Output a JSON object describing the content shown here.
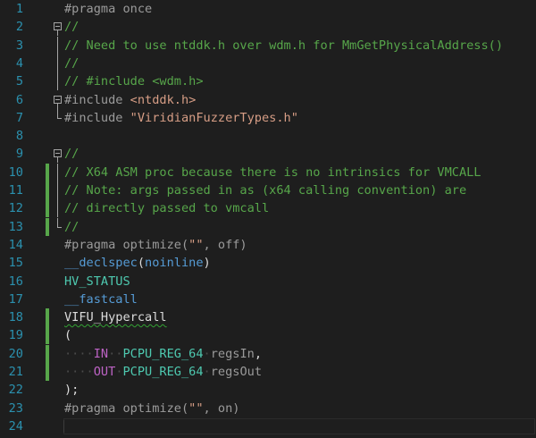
{
  "editor": {
    "language": "C",
    "lines": [
      {
        "number": "1",
        "parts": [
          {
            "t": "pp",
            "s": "#pragma once"
          }
        ]
      },
      {
        "number": "2",
        "parts": [
          {
            "t": "cm",
            "s": "//"
          }
        ]
      },
      {
        "number": "3",
        "parts": [
          {
            "t": "cm",
            "s": "// Need to use ntddk.h over wdm.h for MmGetPhysicalAddress()"
          }
        ]
      },
      {
        "number": "4",
        "parts": [
          {
            "t": "cm",
            "s": "//"
          }
        ]
      },
      {
        "number": "5",
        "parts": [
          {
            "t": "cm",
            "s": "// #include <wdm.h>"
          }
        ]
      },
      {
        "number": "6",
        "parts": [
          {
            "t": "pp",
            "s": "#include "
          },
          {
            "t": "str",
            "s": "<ntddk.h>"
          }
        ]
      },
      {
        "number": "7",
        "parts": [
          {
            "t": "pp",
            "s": "#include "
          },
          {
            "t": "str",
            "s": "\"ViridianFuzzerTypes.h\""
          }
        ]
      },
      {
        "number": "8",
        "parts": []
      },
      {
        "number": "9",
        "parts": [
          {
            "t": "cm",
            "s": "//"
          }
        ]
      },
      {
        "number": "10",
        "parts": [
          {
            "t": "cm",
            "s": "// X64 ASM proc because there is no intrinsics for VMCALL"
          }
        ]
      },
      {
        "number": "11",
        "parts": [
          {
            "t": "cm",
            "s": "// Note: args passed in as (x64 calling convention) are"
          }
        ]
      },
      {
        "number": "12",
        "parts": [
          {
            "t": "cm",
            "s": "// directly passed to vmcall"
          }
        ]
      },
      {
        "number": "13",
        "parts": [
          {
            "t": "cm",
            "s": "//"
          }
        ]
      },
      {
        "number": "14",
        "parts": [
          {
            "t": "pp",
            "s": "#pragma optimize("
          },
          {
            "t": "str",
            "s": "\"\""
          },
          {
            "t": "pp",
            "s": ", off)"
          }
        ]
      },
      {
        "number": "15",
        "parts": [
          {
            "t": "kw",
            "s": "__declspec"
          },
          {
            "t": "id",
            "s": "("
          },
          {
            "t": "kw",
            "s": "noinline"
          },
          {
            "t": "id",
            "s": ")"
          }
        ]
      },
      {
        "number": "16",
        "parts": [
          {
            "t": "typ",
            "s": "HV_STATUS"
          }
        ]
      },
      {
        "number": "17",
        "parts": [
          {
            "t": "kw",
            "s": "__fastcall"
          }
        ]
      },
      {
        "number": "18",
        "parts": [
          {
            "t": "id squig",
            "s": "VIFU_Hypercall"
          }
        ]
      },
      {
        "number": "19",
        "parts": [
          {
            "t": "id",
            "s": "("
          }
        ]
      },
      {
        "number": "20",
        "parts": [
          {
            "t": "ws",
            "s": "····"
          },
          {
            "t": "mac",
            "s": "IN"
          },
          {
            "t": "ws",
            "s": "··"
          },
          {
            "t": "typ",
            "s": "PCPU_REG_64"
          },
          {
            "t": "ws",
            "s": "·"
          },
          {
            "t": "par",
            "s": "regsIn"
          },
          {
            "t": "id",
            "s": ","
          }
        ]
      },
      {
        "number": "21",
        "parts": [
          {
            "t": "ws",
            "s": "····"
          },
          {
            "t": "mac",
            "s": "OUT"
          },
          {
            "t": "ws",
            "s": "·"
          },
          {
            "t": "typ",
            "s": "PCPU_REG_64"
          },
          {
            "t": "ws",
            "s": "·"
          },
          {
            "t": "par",
            "s": "regsOut"
          }
        ]
      },
      {
        "number": "22",
        "parts": [
          {
            "t": "id",
            "s": ");"
          }
        ]
      },
      {
        "number": "23",
        "parts": [
          {
            "t": "pp",
            "s": "#pragma optimize("
          },
          {
            "t": "str",
            "s": "\"\""
          },
          {
            "t": "pp",
            "s": ", on)"
          }
        ]
      },
      {
        "number": "24",
        "parts": []
      }
    ]
  },
  "colors": {
    "background": "#1e1e1e",
    "line_number": "#2b91af",
    "comment": "#57a64a",
    "preprocessor": "#9b9b9b",
    "string": "#d69d85",
    "keyword": "#569cd6",
    "macro": "#bd63c5",
    "type": "#4ec9b0",
    "parameter": "#9a9a9a",
    "change_bar": "#57a64a"
  }
}
